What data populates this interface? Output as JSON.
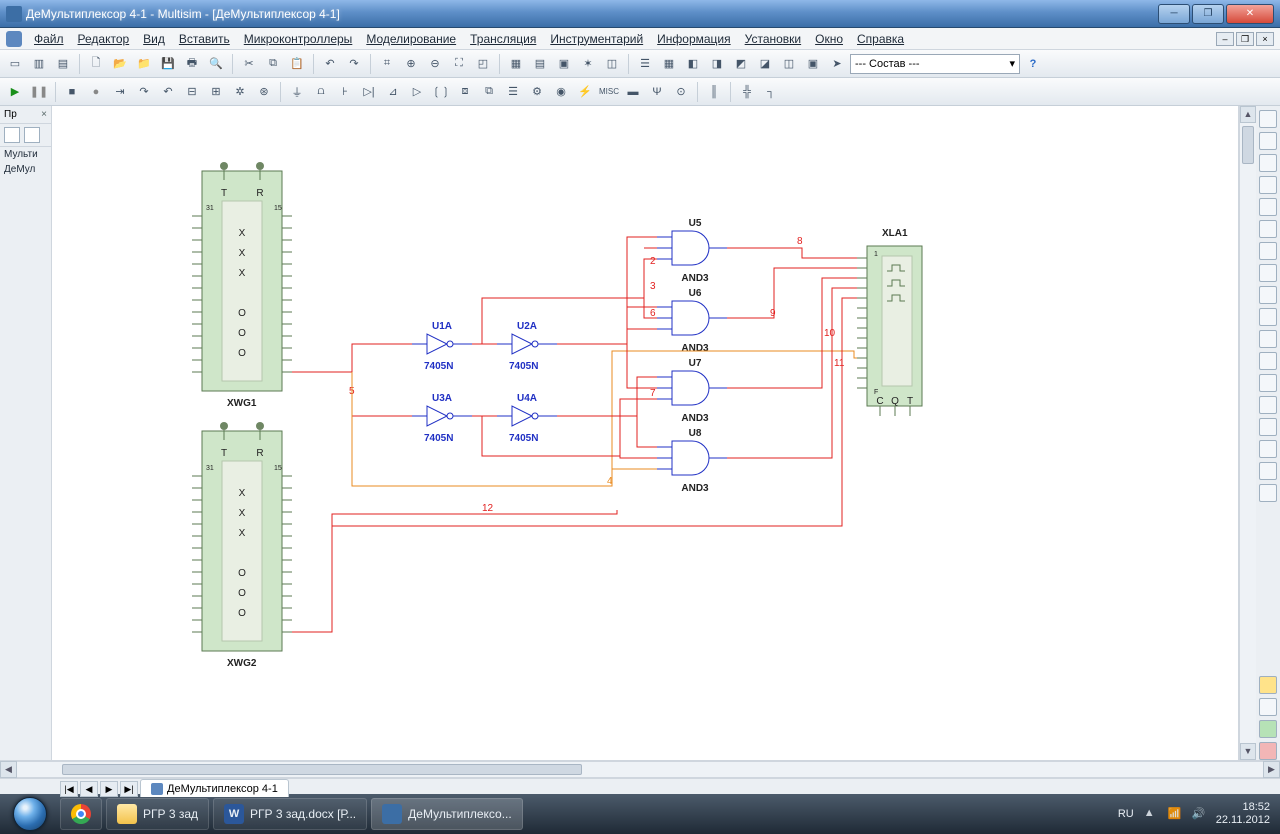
{
  "window": {
    "title": "ДеМультиплексор 4-1 - Multisim - [ДеМультиплексор 4-1]"
  },
  "menu": [
    "Файл",
    "Редактор",
    "Вид",
    "Вставить",
    "Микроконтроллеры",
    "Моделирование",
    "Трансляция",
    "Инструментарий",
    "Информация",
    "Установки",
    "Окно",
    "Справка"
  ],
  "compose_dropdown": "--- Состав ---",
  "left_panel": {
    "title": "Пр",
    "items": [
      "Мульти",
      "ДеМул"
    ]
  },
  "doc_tab": "ДеМультиплексор 4-1",
  "components": {
    "xwg1": {
      "name": "XWG1",
      "cols": [
        "T",
        "R"
      ],
      "center": [
        "X",
        "X",
        "X",
        "O",
        "O",
        "O"
      ],
      "tl": "31",
      "tr": "15"
    },
    "xwg2": {
      "name": "XWG2",
      "cols": [
        "T",
        "R"
      ],
      "center": [
        "X",
        "X",
        "X",
        "O",
        "O",
        "O"
      ],
      "tl": "31",
      "tr": "15"
    },
    "inverters": [
      {
        "ref": "U1A",
        "part": "7405N"
      },
      {
        "ref": "U2A",
        "part": "7405N"
      },
      {
        "ref": "U3A",
        "part": "7405N"
      },
      {
        "ref": "U4A",
        "part": "7405N"
      }
    ],
    "and_gates": [
      {
        "ref": "U5",
        "type": "AND3"
      },
      {
        "ref": "U6",
        "type": "AND3"
      },
      {
        "ref": "U7",
        "type": "AND3"
      },
      {
        "ref": "U8",
        "type": "AND3"
      }
    ],
    "xla1": {
      "name": "XLA1",
      "bottom": [
        "C",
        "Q",
        "T"
      ],
      "f": "F",
      "one": "1"
    },
    "net_labels": [
      "2",
      "3",
      "4",
      "5",
      "6",
      "7",
      "8",
      "9",
      "10",
      "11",
      "12"
    ]
  },
  "taskbar": {
    "items": [
      {
        "kind": "chrome",
        "label": ""
      },
      {
        "kind": "folder",
        "label": "РГР 3 зад"
      },
      {
        "kind": "word",
        "label": "РГР 3 зад.docx [Р..."
      },
      {
        "kind": "ms",
        "label": "ДеМультиплексо..."
      }
    ],
    "lang": "RU",
    "time": "18:52",
    "date": "22.11.2012"
  }
}
